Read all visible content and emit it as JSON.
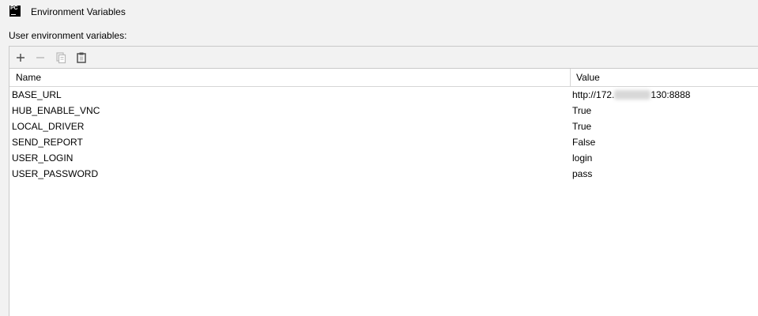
{
  "window": {
    "title": "Environment Variables",
    "logo_text": "PC"
  },
  "section_label": "User environment variables:",
  "toolbar": {
    "buttons": [
      {
        "name": "add",
        "icon": "plus-icon",
        "enabled": true
      },
      {
        "name": "remove",
        "icon": "minus-icon",
        "enabled": false
      },
      {
        "name": "copy",
        "icon": "copy-icon",
        "enabled": false
      },
      {
        "name": "paste",
        "icon": "clipboard-icon",
        "enabled": true
      }
    ]
  },
  "table": {
    "columns": [
      "Name",
      "Value"
    ],
    "rows": [
      {
        "name": "BASE_URL",
        "value_prefix": "http://172.",
        "value_suffix": "130:8888",
        "redacted": true
      },
      {
        "name": "HUB_ENABLE_VNC",
        "value": "True"
      },
      {
        "name": "LOCAL_DRIVER",
        "value": "True"
      },
      {
        "name": "SEND_REPORT",
        "value": "False"
      },
      {
        "name": "USER_LOGIN",
        "value": "login"
      },
      {
        "name": "USER_PASSWORD",
        "value": "pass"
      }
    ]
  },
  "colors": {
    "background": "#f2f2f2",
    "panel": "#ffffff",
    "border": "#c9c9c9",
    "icon_enabled": "#505050",
    "icon_disabled": "#b9b9b9"
  }
}
